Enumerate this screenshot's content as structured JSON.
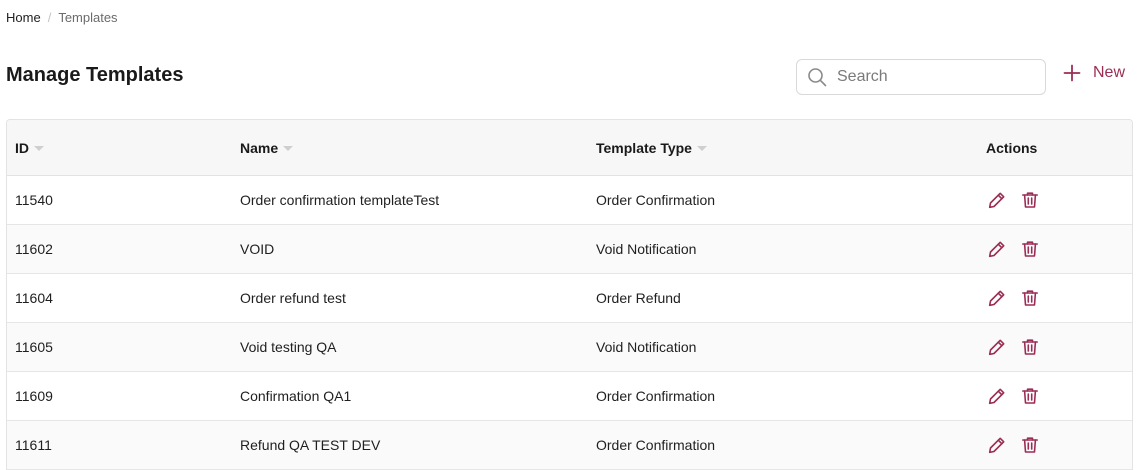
{
  "breadcrumb": {
    "home": "Home",
    "separator": "/",
    "current": "Templates"
  },
  "page": {
    "title": "Manage Templates"
  },
  "search": {
    "placeholder": "Search",
    "value": ""
  },
  "new_button": {
    "label": "New"
  },
  "table": {
    "columns": [
      {
        "label": "ID",
        "sortable": true
      },
      {
        "label": "Name",
        "sortable": true
      },
      {
        "label": "Template Type",
        "sortable": true
      },
      {
        "label": "Actions",
        "sortable": false
      }
    ],
    "rows": [
      {
        "id": "11540",
        "name": "Order confirmation templateTest",
        "type": "Order Confirmation"
      },
      {
        "id": "11602",
        "name": "VOID",
        "type": "Void Notification"
      },
      {
        "id": "11604",
        "name": "Order refund test",
        "type": "Order Refund"
      },
      {
        "id": "11605",
        "name": "Void testing QA",
        "type": "Void Notification"
      },
      {
        "id": "11609",
        "name": "Confirmation QA1",
        "type": "Order Confirmation"
      },
      {
        "id": "11611",
        "name": "Refund QA TEST DEV",
        "type": "Order Confirmation"
      }
    ],
    "row_actions": [
      "edit-icon",
      "delete-icon"
    ]
  },
  "colors": {
    "accent": "#9b2d55",
    "header_bg": "#f7f7f7",
    "border": "#e3e3e3"
  }
}
